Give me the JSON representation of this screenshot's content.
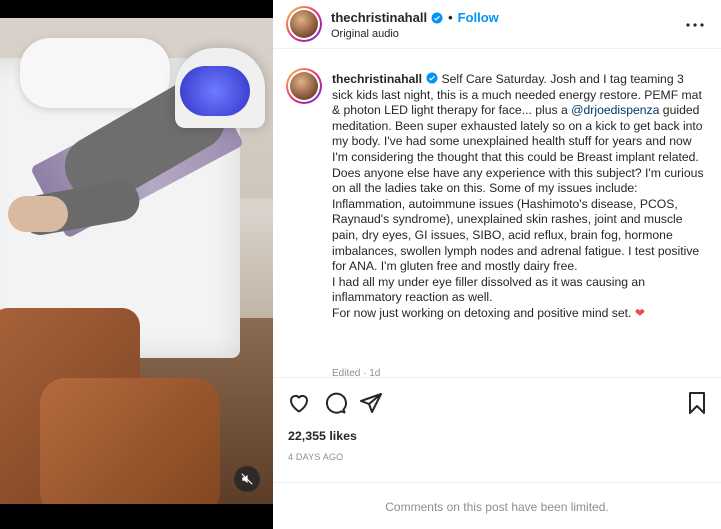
{
  "post": {
    "username": "thechristinahall",
    "follow_label": "Follow",
    "separator": "•",
    "audio": "Original audio",
    "caption_username": "thechristinahall",
    "caption_part1": " Self Care Saturday. Josh and I tag teaming 3 sick kids last night, this is a much needed energy restore. PEMF mat & photon LED light therapy for face... plus a ",
    "caption_mention": "@drjoedispenza",
    "caption_part2": " guided meditation. Been super exhausted lately so on a kick to get back into my body. I've had some unexplained health stuff for years and now I'm considering the thought that this could be Breast implant related. Does anyone else have any experience with this subject? I'm curious on all the ladies take on this. Some of my issues include: Inflammation, autoimmune issues (Hashimoto's disease, PCOS, Raynaud's syndrome), unexplained skin rashes, joint and muscle pain, dry eyes, GI issues, SIBO, acid reflux, brain fog, hormone imbalances, swollen lymph nodes and adrenal fatigue. I test positive for ANA. I'm gluten free and mostly dairy free.\nI had all my under eye filler dissolved as it was causing an inflammatory reaction as well.\nFor now just working on detoxing and positive mind set. ",
    "caption_heart": "❤",
    "edited": "Edited · 1d",
    "likes": "22,355 likes",
    "date": "4 DAYS AGO",
    "comments_limited": "Comments on this post have been limited."
  },
  "colors": {
    "accent": "#0095f6",
    "verified": "#0095f6",
    "heart": "#ed4956",
    "mention": "#00376b",
    "muted_text": "#8e8e8e"
  },
  "icons": {
    "header_more": "more-options-icon",
    "like": "heart-icon",
    "comment": "comment-icon",
    "share": "share-icon",
    "save": "bookmark-icon",
    "mute": "muted-speaker-icon"
  }
}
